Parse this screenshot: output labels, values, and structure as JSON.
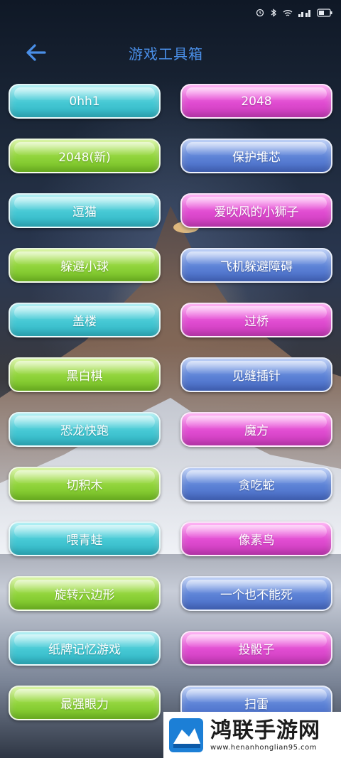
{
  "status": {
    "icons": [
      "alarm-icon",
      "bluetooth-icon",
      "wifi-icon",
      "signal-icon",
      "battery-icon"
    ]
  },
  "appbar": {
    "title": "游戏工具箱"
  },
  "games": [
    {
      "label": "0hh1",
      "color": "cyan"
    },
    {
      "label": "2048",
      "color": "magenta"
    },
    {
      "label": "2048(新)",
      "color": "lime"
    },
    {
      "label": "保护堆芯",
      "color": "blue"
    },
    {
      "label": "逗猫",
      "color": "cyan"
    },
    {
      "label": "爱吹风的小狮子",
      "color": "magenta"
    },
    {
      "label": "躲避小球",
      "color": "lime"
    },
    {
      "label": "飞机躲避障碍",
      "color": "blue"
    },
    {
      "label": "盖楼",
      "color": "cyan"
    },
    {
      "label": "过桥",
      "color": "magenta"
    },
    {
      "label": "黑白棋",
      "color": "lime"
    },
    {
      "label": "见缝插针",
      "color": "blue"
    },
    {
      "label": "恐龙快跑",
      "color": "cyan"
    },
    {
      "label": "魔方",
      "color": "magenta"
    },
    {
      "label": "切积木",
      "color": "lime"
    },
    {
      "label": "贪吃蛇",
      "color": "blue"
    },
    {
      "label": "喂青蛙",
      "color": "cyan"
    },
    {
      "label": "像素鸟",
      "color": "magenta"
    },
    {
      "label": "旋转六边形",
      "color": "lime"
    },
    {
      "label": "一个也不能死",
      "color": "blue"
    },
    {
      "label": "纸牌记忆游戏",
      "color": "cyan"
    },
    {
      "label": "投骰子",
      "color": "magenta"
    },
    {
      "label": "最强眼力",
      "color": "lime"
    },
    {
      "label": "扫雷",
      "color": "blue"
    }
  ],
  "watermark": {
    "title": "鸿联手游网",
    "url": "www.henanhonglian95.com"
  }
}
